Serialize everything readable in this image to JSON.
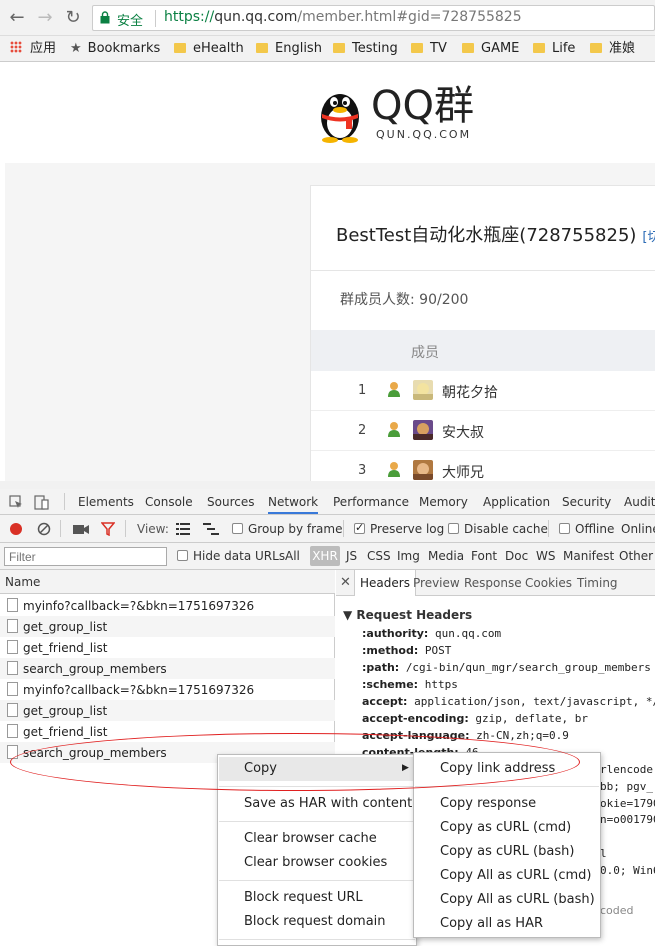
{
  "browser": {
    "security_label": "安全",
    "url_scheme": "https://",
    "url_host": "qun.qq.com",
    "url_rest": "/member.html#gid=728755825"
  },
  "bookmarks": [
    "应用",
    "Bookmarks",
    "eHealth",
    "English",
    "Testing",
    "TV",
    "GAME",
    "Life",
    "准娘"
  ],
  "page": {
    "logo_text": "QQ群",
    "logo_sub": "QUN.QQ.COM",
    "group_title": "BestTest自动化水瓶座(728755825)",
    "switch_link": "[切换",
    "member_count": "群成员人数: 90/200",
    "column_header": "成员",
    "members": [
      {
        "num": "1",
        "name": "朝花夕拾"
      },
      {
        "num": "2",
        "name": "安大叔"
      },
      {
        "num": "3",
        "name": "大师兄"
      }
    ]
  },
  "devtools": {
    "tabs": [
      "Elements",
      "Console",
      "Sources",
      "Network",
      "Performance",
      "Memory",
      "Application",
      "Security",
      "Audit"
    ],
    "active_tab": "Network",
    "toolbar": {
      "view_label": "View:",
      "group_by_frame": "Group by frame",
      "preserve_log": "Preserve log",
      "disable_cache": "Disable cache",
      "offline": "Offline",
      "online": "Online"
    },
    "filter": {
      "placeholder": "Filter",
      "hide_data_urls": "Hide data URLs",
      "types": [
        "All",
        "XHR",
        "JS",
        "CSS",
        "Img",
        "Media",
        "Font",
        "Doc",
        "WS",
        "Manifest",
        "Other"
      ]
    },
    "name_header": "Name",
    "requests": [
      "myinfo?callback=?&bkn=1751697326",
      "get_group_list",
      "get_friend_list",
      "search_group_members",
      "myinfo?callback=?&bkn=1751697326",
      "get_group_list",
      "get_friend_list",
      "search_group_members"
    ],
    "detail_tabs": [
      "Headers",
      "Preview",
      "Response",
      "Cookies",
      "Timing"
    ],
    "close_glyph": "✕",
    "request_headers_title": "▼ Request Headers",
    "headers": [
      {
        "k": ":authority:",
        "v": "qun.qq.com"
      },
      {
        "k": ":method:",
        "v": "POST"
      },
      {
        "k": ":path:",
        "v": "/cgi-bin/qun_mgr/search_group_members"
      },
      {
        "k": ":scheme:",
        "v": "https"
      },
      {
        "k": "accept:",
        "v": "application/json, text/javascript, */*"
      },
      {
        "k": "accept-encoding:",
        "v": "gzip, deflate, br"
      },
      {
        "k": "accept-language:",
        "v": "zh-CN,zh;q=0.9"
      },
      {
        "k": "content-length:",
        "v": "46"
      }
    ],
    "peek_fragments": [
      "rlencode",
      "bb; pgv_",
      "okie=1790",
      "n=o001790",
      "l",
      "0.0; Win6",
      "coded"
    ]
  },
  "context_menu": {
    "items": [
      "Copy",
      "Save as HAR with content",
      "Clear browser cache",
      "Clear browser cookies",
      "Block request URL",
      "Block request domain"
    ],
    "submenu_arrow": "▶"
  },
  "copy_submenu": {
    "items": [
      "Copy link address",
      "Copy response",
      "Copy as cURL (cmd)",
      "Copy as cURL (bash)",
      "Copy All as cURL (cmd)",
      "Copy All as cURL (bash)",
      "Copy all as HAR"
    ]
  },
  "colors": {
    "accent": "#3879d9",
    "secure_green": "#0b8043",
    "annotation_red": "#e02020"
  }
}
